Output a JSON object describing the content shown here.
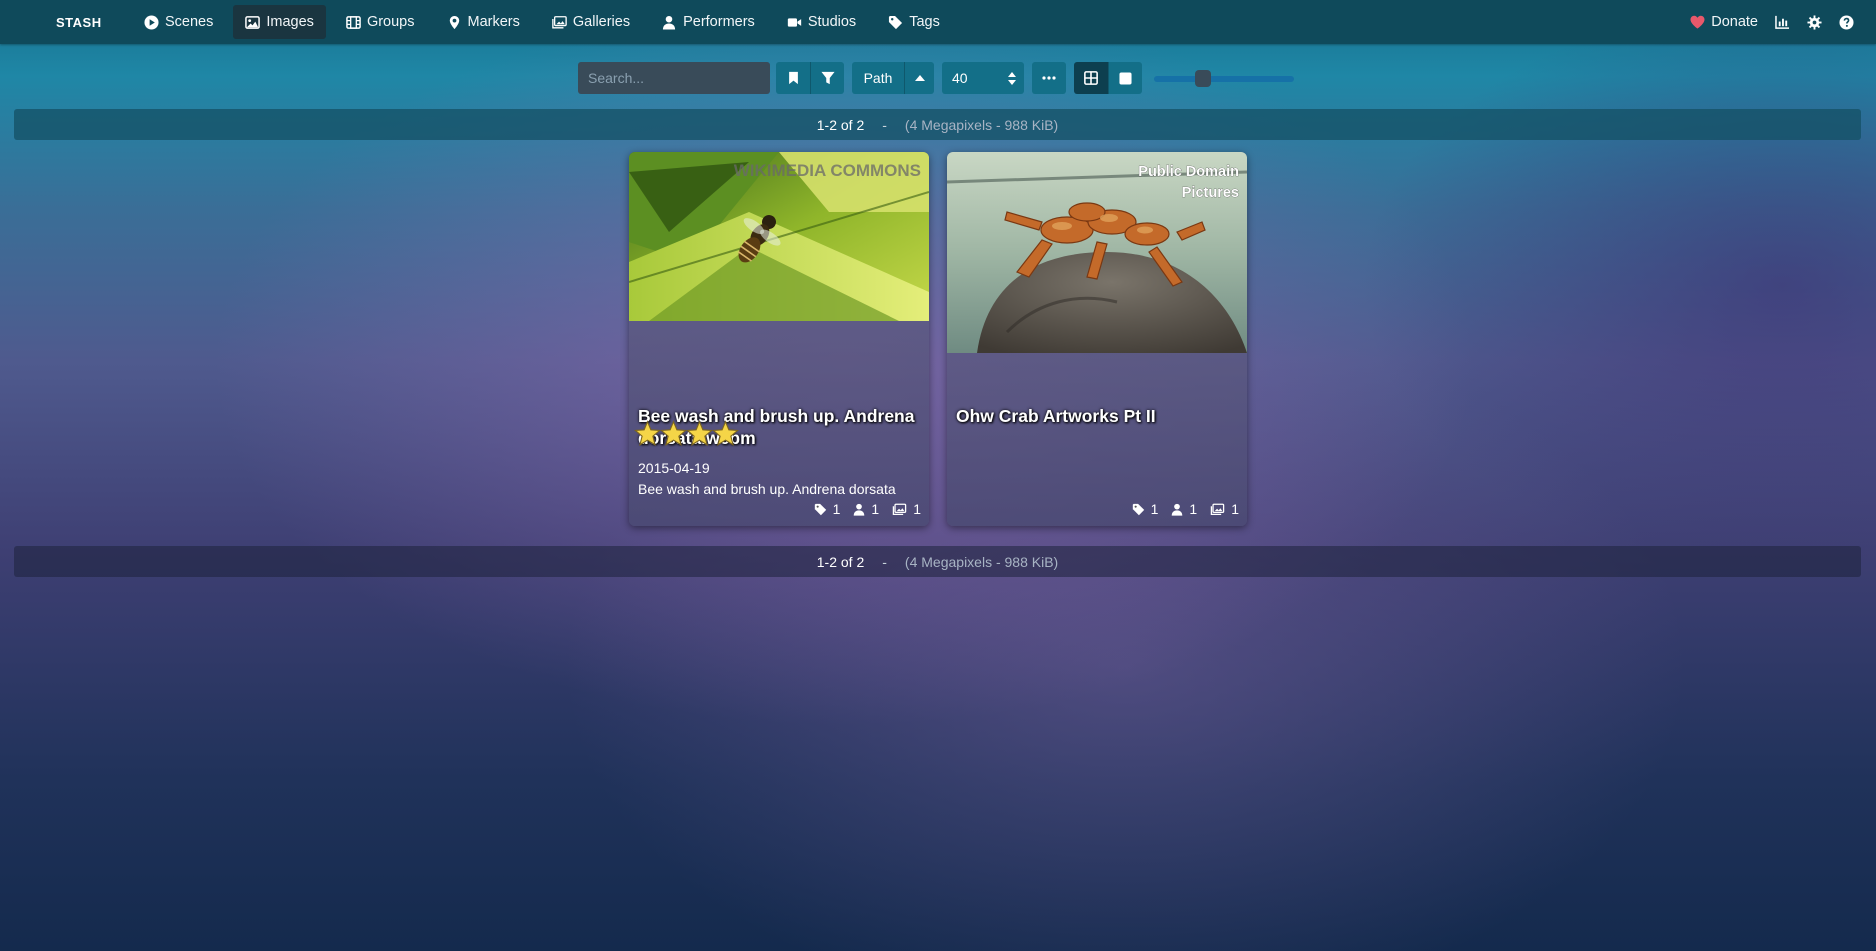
{
  "nav": {
    "brand": "STASH",
    "items": [
      {
        "label": "Scenes",
        "icon": "play-circle-icon",
        "active": false
      },
      {
        "label": "Images",
        "icon": "image-icon",
        "active": true
      },
      {
        "label": "Groups",
        "icon": "film-icon",
        "active": false
      },
      {
        "label": "Markers",
        "icon": "map-marker-icon",
        "active": false
      },
      {
        "label": "Galleries",
        "icon": "images-icon",
        "active": false
      },
      {
        "label": "Performers",
        "icon": "user-icon",
        "active": false
      },
      {
        "label": "Studios",
        "icon": "video-camera-icon",
        "active": false
      },
      {
        "label": "Tags",
        "icon": "tag-icon",
        "active": false
      }
    ],
    "donate_label": "Donate",
    "right_icons": [
      "chart-icon",
      "gear-icon",
      "help-icon"
    ]
  },
  "toolbar": {
    "search_placeholder": "Search...",
    "sort_label": "Path",
    "per_page": "40",
    "zoom_level": 0.33
  },
  "stats": {
    "count": "1-2 of 2",
    "separator": "-",
    "summary": "(4 Megapixels - 988 KiB)"
  },
  "cards": [
    {
      "title": "Bee wash and brush up. Andrena dorsata.webm",
      "rating": 4,
      "date": "2015-04-19",
      "description": "Bee wash and brush up. Andrena dorsata",
      "watermark": "WIKIMEDIA COMMONS",
      "tags": "1",
      "performers": "1",
      "galleries": "1"
    },
    {
      "title": "Ohw Crab Artworks Pt II",
      "watermark_line1": "Public Domain",
      "watermark_line2": "Pictures",
      "tags": "1",
      "performers": "1",
      "galleries": "1"
    }
  ],
  "colors": {
    "navbar": "#0f4a5b",
    "button": "#136f88",
    "donate_heart": "#e8586b",
    "star": "#f5d547"
  }
}
